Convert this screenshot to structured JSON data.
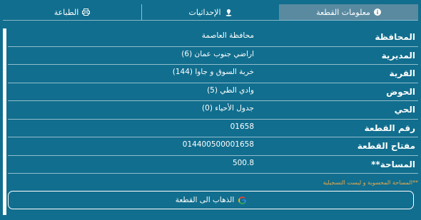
{
  "tabs": [
    {
      "label": "معلومات القطعة",
      "icon": "info-icon"
    },
    {
      "label": "الإحداثيات",
      "icon": "location-pin-icon"
    },
    {
      "label": "الطباعة",
      "icon": "printer-icon"
    }
  ],
  "rows": [
    {
      "label": "المحافظة",
      "value": "محافظة العاصمة"
    },
    {
      "label": "المديرية",
      "value": "اراضي جنوب عمان (6)"
    },
    {
      "label": "القرية",
      "value": "خربة السوق و جاوا (144)"
    },
    {
      "label": "الحوض",
      "value": "وادي الطي (5)"
    },
    {
      "label": "الحي",
      "value": "جدول الأحياء (0)"
    },
    {
      "label": "رقم القطعة",
      "value": "01658"
    },
    {
      "label": "مفتاح القطعة",
      "value": "014400500001658"
    },
    {
      "label": "المساحة**",
      "value": "500.8"
    }
  ],
  "note": "**المساحة المحسوبة و ليست التسجيلية",
  "go_button": {
    "label": "الذهاب الى القطعة",
    "icon": "google-icon"
  },
  "colors": {
    "background": "#116e8e",
    "active_tab": "#5a8aa0",
    "note": "#e8a94b"
  }
}
